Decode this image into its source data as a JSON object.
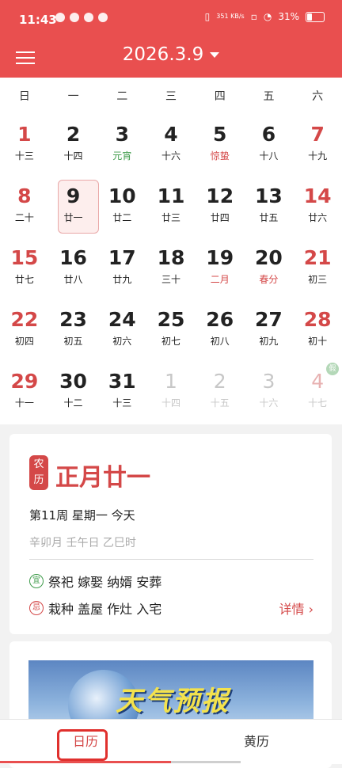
{
  "status": {
    "time": "11:43",
    "net_speed": "351 KB/s",
    "battery": "31%"
  },
  "header": {
    "date": "2026.3.9"
  },
  "weekdays": [
    "日",
    "一",
    "二",
    "三",
    "四",
    "五",
    "六"
  ],
  "days": [
    {
      "n": "1",
      "l": "十三"
    },
    {
      "n": "2",
      "l": "十四"
    },
    {
      "n": "3",
      "l": "元宵"
    },
    {
      "n": "4",
      "l": "十六"
    },
    {
      "n": "5",
      "l": "惊蛰"
    },
    {
      "n": "6",
      "l": "十八"
    },
    {
      "n": "7",
      "l": "十九"
    },
    {
      "n": "8",
      "l": "二十"
    },
    {
      "n": "9",
      "l": "廿一"
    },
    {
      "n": "10",
      "l": "廿二"
    },
    {
      "n": "11",
      "l": "廿三"
    },
    {
      "n": "12",
      "l": "廿四"
    },
    {
      "n": "13",
      "l": "廿五"
    },
    {
      "n": "14",
      "l": "廿六"
    },
    {
      "n": "15",
      "l": "廿七"
    },
    {
      "n": "16",
      "l": "廿八"
    },
    {
      "n": "17",
      "l": "廿九"
    },
    {
      "n": "18",
      "l": "三十"
    },
    {
      "n": "19",
      "l": "二月"
    },
    {
      "n": "20",
      "l": "春分"
    },
    {
      "n": "21",
      "l": "初三"
    },
    {
      "n": "22",
      "l": "初四"
    },
    {
      "n": "23",
      "l": "初五"
    },
    {
      "n": "24",
      "l": "初六"
    },
    {
      "n": "25",
      "l": "初七"
    },
    {
      "n": "26",
      "l": "初八"
    },
    {
      "n": "27",
      "l": "初九"
    },
    {
      "n": "28",
      "l": "初十"
    },
    {
      "n": "29",
      "l": "十一"
    },
    {
      "n": "30",
      "l": "十二"
    },
    {
      "n": "31",
      "l": "十三"
    },
    {
      "n": "1",
      "l": "十四"
    },
    {
      "n": "2",
      "l": "十五"
    },
    {
      "n": "3",
      "l": "十六"
    },
    {
      "n": "4",
      "l": "十七"
    }
  ],
  "holiday_badge": "假",
  "almanac": {
    "badge": "农历",
    "lunar_date": "正月廿一",
    "week_line": "第11周 星期一 今天",
    "ganzhi": "辛卯月 壬午日 乙巳时",
    "yi_label": "宜",
    "yi": "祭祀 嫁娶 纳婿 安葬",
    "ji_label": "忌",
    "ji": "栽种 盖屋 作灶 入宅",
    "details": "详情 ›"
  },
  "weather_banner": {
    "text": "天气预报"
  },
  "tabs": {
    "calendar": "日历",
    "almanac": "黄历"
  },
  "colors": {
    "brand": "#e94f4f",
    "holiday_red": "#d44848",
    "festival_green": "#3e9b4a"
  }
}
